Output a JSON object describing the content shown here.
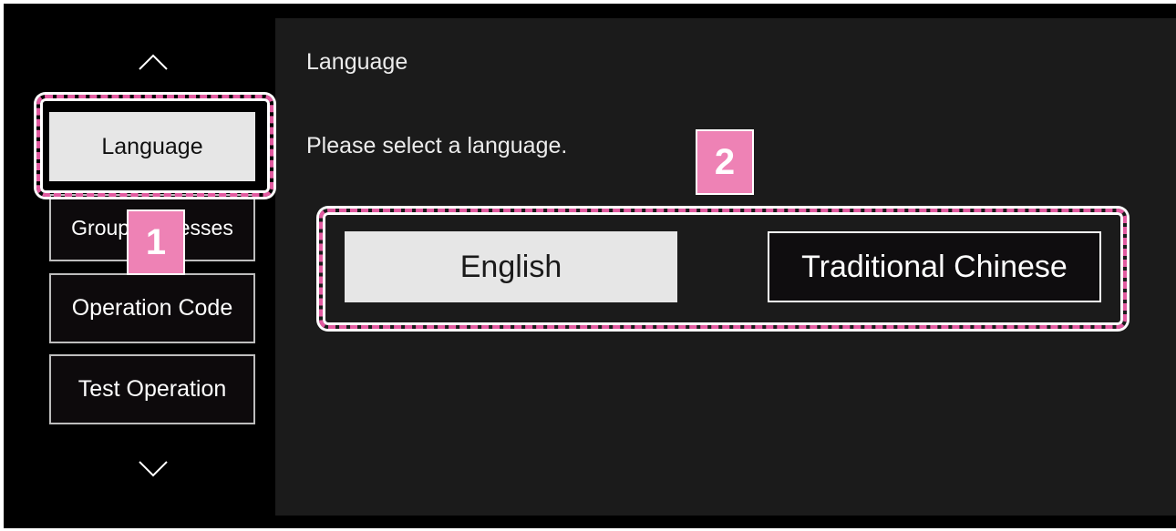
{
  "sidebar": {
    "items": [
      {
        "label": "Language",
        "active": true
      },
      {
        "label": "Group Addresses",
        "active": false
      },
      {
        "label": "Operation Code",
        "active": false
      },
      {
        "label": "Test Operation",
        "active": false
      }
    ],
    "scroll_up_icon": "chevron-up-icon",
    "scroll_down_icon": "chevron-down-icon"
  },
  "panel": {
    "title": "Language",
    "prompt": "Please select a language.",
    "options": [
      {
        "label": "English",
        "selected": true
      },
      {
        "label": "Traditional Chinese",
        "selected": false
      }
    ]
  },
  "callouts": [
    {
      "number": "1"
    },
    {
      "number": "2"
    }
  ],
  "colors": {
    "callout_pink": "#ee82b5",
    "callout_border": "#e25aa0",
    "panel_bg": "#1b1b1b",
    "selected_bg": "#e6e6e6"
  }
}
